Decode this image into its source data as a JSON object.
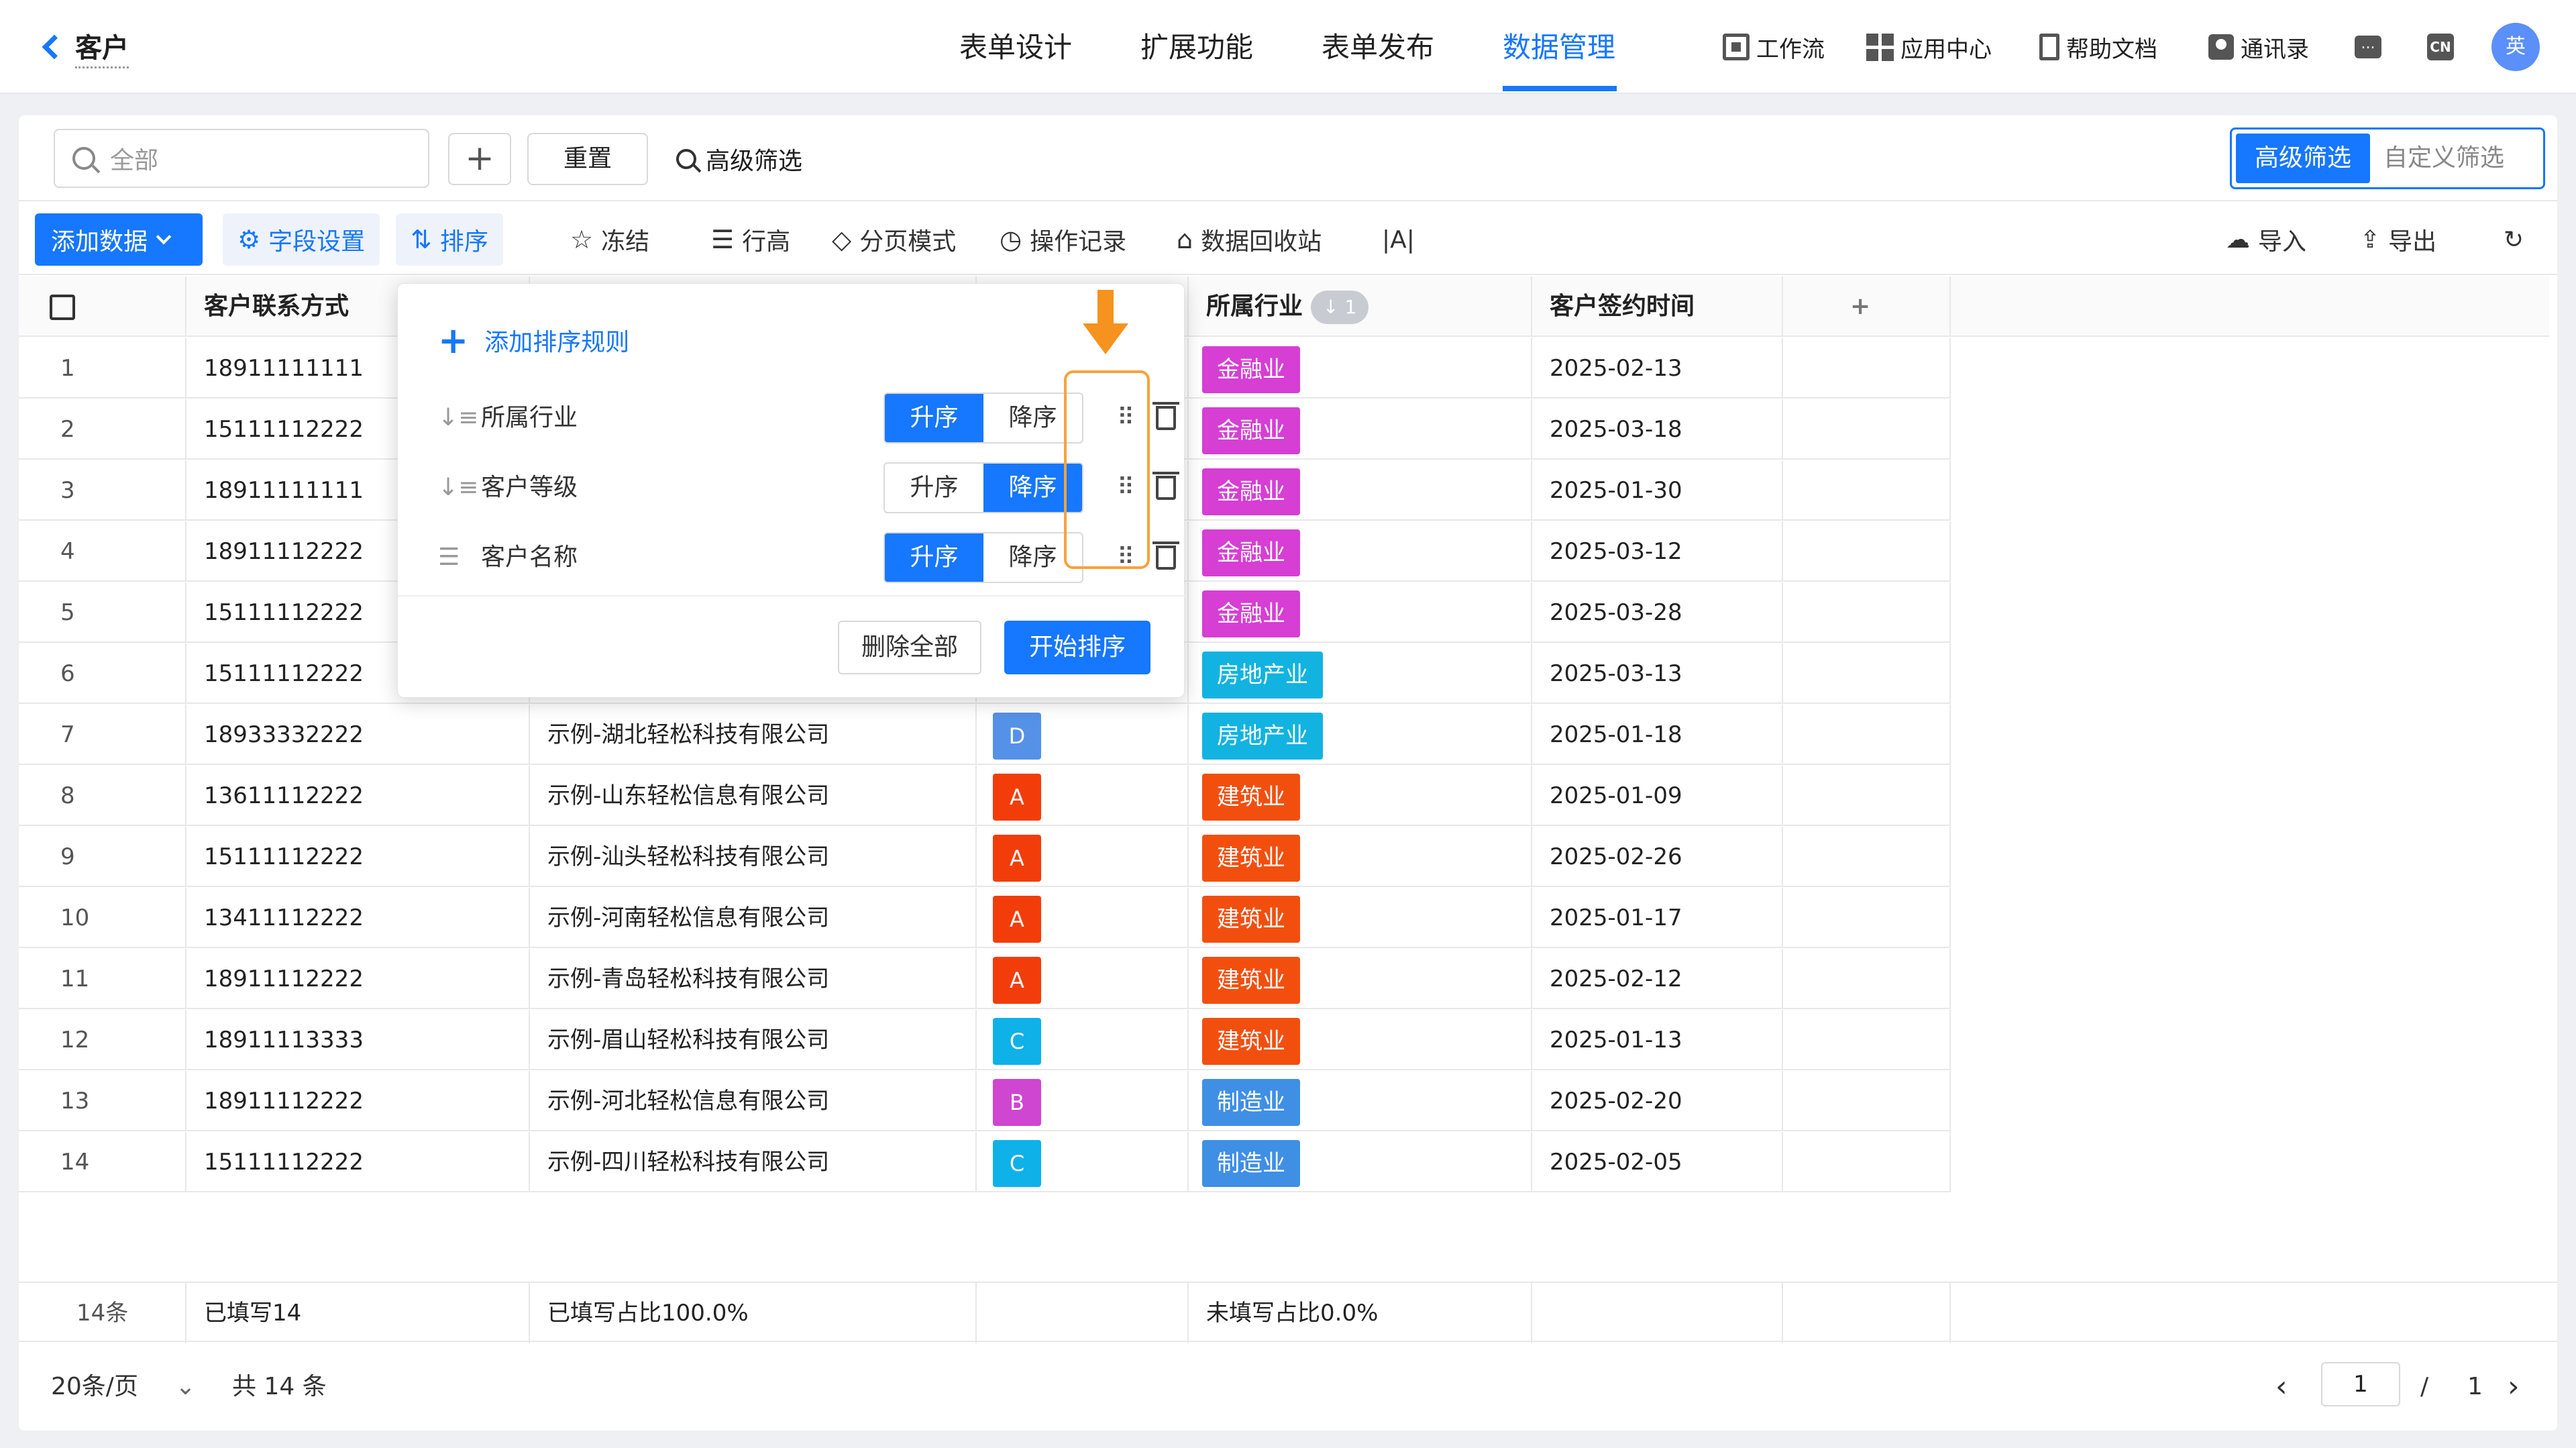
{
  "app": {
    "title": "客户"
  },
  "nav": {
    "tabs": [
      "表单设计",
      "扩展功能",
      "表单发布",
      "数据管理"
    ],
    "active": "数据管理"
  },
  "tools": {
    "workflow": "工作流",
    "app_center": "应用中心",
    "help_docs": "帮助文档",
    "contacts": "通讯录",
    "chat_icon": "...",
    "lang_icon": "CN",
    "avatar": "英"
  },
  "filter": {
    "search_placeholder": "全部",
    "plus": "+",
    "reset": "重置",
    "advanced": "高级筛选",
    "seg_advanced": "高级筛选",
    "seg_custom": "自定义筛选"
  },
  "toolbar": {
    "add_data": "添加数据",
    "field_settings": "字段设置",
    "sort": "排序",
    "freeze": "冻结",
    "row_height": "行高",
    "pagination_mode": "分页模式",
    "op_log": "操作记录",
    "recycle": "数据回收站",
    "ai_icon": "|A|",
    "import": "导入",
    "export": "导出"
  },
  "columns": {
    "phone": "客户联系方式",
    "industry": "所属行业",
    "industry_sort_badge": "↓ 1",
    "sign_date": "客户签约时间",
    "add": "+"
  },
  "colors": {
    "accent": "#1677ff",
    "finance": "#d63ed4",
    "realestate": "#12b3e0",
    "construction": "#f24f0f",
    "manufacturing": "#3f8fe5",
    "grade_A": "#f23d0a",
    "grade_B": "#cf46d0",
    "grade_C": "#0fb1e9",
    "grade_D": "#5591e7",
    "arrow": "#f6921e"
  },
  "rows": [
    {
      "idx": "1",
      "phone": "18911111111",
      "company": "",
      "grade": "",
      "industry": "金融业",
      "industry_color": "#d63ed4",
      "date": "2025-02-13"
    },
    {
      "idx": "2",
      "phone": "15111112222",
      "company": "",
      "grade": "",
      "industry": "金融业",
      "industry_color": "#d63ed4",
      "date": "2025-03-18"
    },
    {
      "idx": "3",
      "phone": "18911111111",
      "company": "",
      "grade": "",
      "industry": "金融业",
      "industry_color": "#d63ed4",
      "date": "2025-01-30"
    },
    {
      "idx": "4",
      "phone": "18911112222",
      "company": "",
      "grade": "",
      "industry": "金融业",
      "industry_color": "#d63ed4",
      "date": "2025-03-12"
    },
    {
      "idx": "5",
      "phone": "15111112222",
      "company": "",
      "grade": "",
      "industry": "金融业",
      "industry_color": "#d63ed4",
      "date": "2025-03-28"
    },
    {
      "idx": "6",
      "phone": "15111112222",
      "company": "",
      "grade": "",
      "industry": "房地产业",
      "industry_color": "#12b3e0",
      "date": "2025-03-13"
    },
    {
      "idx": "7",
      "phone": "18933332222",
      "company": "示例-湖北轻松科技有限公司",
      "grade": "D",
      "grade_color": "#5591e7",
      "industry": "房地产业",
      "industry_color": "#12b3e0",
      "date": "2025-01-18"
    },
    {
      "idx": "8",
      "phone": "13611112222",
      "company": "示例-山东轻松信息有限公司",
      "grade": "A",
      "grade_color": "#f23d0a",
      "industry": "建筑业",
      "industry_color": "#f24f0f",
      "date": "2025-01-09"
    },
    {
      "idx": "9",
      "phone": "15111112222",
      "company": "示例-汕头轻松科技有限公司",
      "grade": "A",
      "grade_color": "#f23d0a",
      "industry": "建筑业",
      "industry_color": "#f24f0f",
      "date": "2025-02-26"
    },
    {
      "idx": "10",
      "phone": "13411112222",
      "company": "示例-河南轻松信息有限公司",
      "grade": "A",
      "grade_color": "#f23d0a",
      "industry": "建筑业",
      "industry_color": "#f24f0f",
      "date": "2025-01-17"
    },
    {
      "idx": "11",
      "phone": "18911112222",
      "company": "示例-青岛轻松科技有限公司",
      "grade": "A",
      "grade_color": "#f23d0a",
      "industry": "建筑业",
      "industry_color": "#f24f0f",
      "date": "2025-02-12"
    },
    {
      "idx": "12",
      "phone": "18911113333",
      "company": "示例-眉山轻松科技有限公司",
      "grade": "C",
      "grade_color": "#0fb1e9",
      "industry": "建筑业",
      "industry_color": "#f24f0f",
      "date": "2025-01-13"
    },
    {
      "idx": "13",
      "phone": "18911112222",
      "company": "示例-河北轻松信息有限公司",
      "grade": "B",
      "grade_color": "#cf46d0",
      "industry": "制造业",
      "industry_color": "#3f8fe5",
      "date": "2025-02-20"
    },
    {
      "idx": "14",
      "phone": "15111112222",
      "company": "示例-四川轻松科技有限公司",
      "grade": "C",
      "grade_color": "#0fb1e9",
      "industry": "制造业",
      "industry_color": "#3f8fe5",
      "date": "2025-02-05"
    }
  ],
  "summary": {
    "count": "14条",
    "filled": "已填写14",
    "filled_ratio": "已填写占比100.0%",
    "unfilled_ratio": "未填写占比0.0%"
  },
  "pager": {
    "per_page": "20条/页",
    "total": "共 14 条",
    "current": "1",
    "sep": "/",
    "pages": "1"
  },
  "sort_popover": {
    "add_rule": "添加排序规则",
    "asc": "升序",
    "desc": "降序",
    "rules": [
      {
        "field": "所属行业",
        "order": "asc"
      },
      {
        "field": "客户等级",
        "order": "desc"
      },
      {
        "field": "客户名称",
        "order": "asc"
      }
    ],
    "delete_all": "删除全部",
    "start_sort": "开始排序"
  }
}
